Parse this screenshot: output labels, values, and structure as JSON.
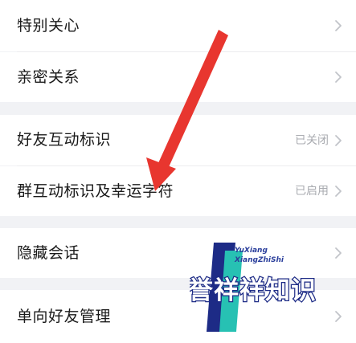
{
  "settings": {
    "items": [
      {
        "label": "特别关心",
        "value": ""
      },
      {
        "label": "亲密关系",
        "value": ""
      },
      {
        "label": "好友互动标识",
        "value": "已关闭"
      },
      {
        "label": "群互动标识及幸运字符",
        "value": "已启用"
      },
      {
        "label": "隐藏会话",
        "value": ""
      },
      {
        "label": "单向好友管理",
        "value": ""
      }
    ]
  },
  "watermark": {
    "line1": "YuXiang",
    "line2": "XiangZhiShi",
    "brand": "誉祥祥知识"
  },
  "colors": {
    "page_bg": "#f1f2f5",
    "row_bg": "#ffffff",
    "arrow": "#e8362f",
    "watermark_dark": "#1d2b86",
    "watermark_teal": "#27c1b3"
  },
  "icons": {
    "chevron": "chevron-right-icon",
    "annotation_arrow": "red-arrow-annotation"
  }
}
